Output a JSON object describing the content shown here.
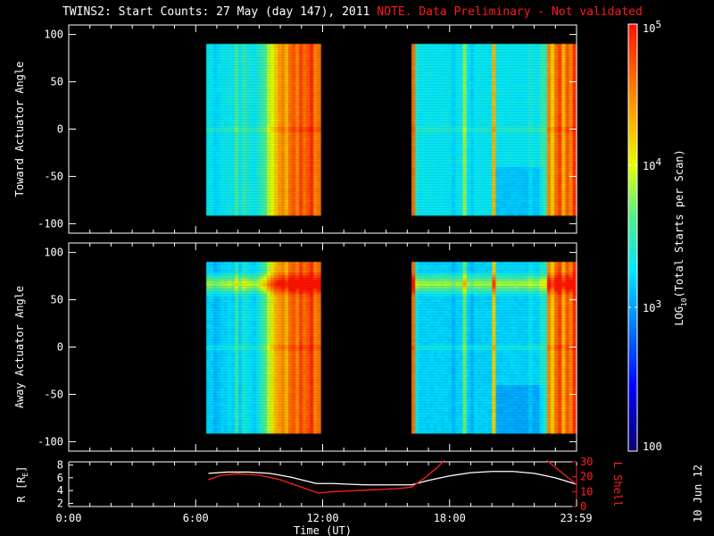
{
  "chart_data": {
    "type": "heatmap",
    "title": "TWINS2: Start Counts: 27 May (day 147), 2011",
    "note": "NOTE. Data Preliminary - Not validated",
    "xlabel": "Time (UT)",
    "x_ticks": [
      "0:00",
      "6:00",
      "12:00",
      "18:00",
      "23:59"
    ],
    "x_tick_hours": [
      0,
      6,
      12,
      18,
      23.98
    ],
    "xlim_hours": [
      0,
      24
    ],
    "panels": [
      {
        "ylabel": "Toward Actuator Angle",
        "ylim": [
          -110,
          110
        ],
        "y_ticks": [
          100,
          50,
          0,
          -50,
          -100
        ],
        "blocks": [
          {
            "start_h": 6.5,
            "end_h": 11.9,
            "angle_range": [
              -90,
              90
            ],
            "col_log10": [
              3.3,
              3.3,
              3.2,
              3.25,
              3.3,
              3.3,
              3.35,
              3.3,
              3.6,
              3.3,
              3.5,
              3.4,
              3.35,
              3.3,
              3.4,
              3.5,
              3.6,
              3.9,
              4.0,
              4.2,
              4.4,
              4.5,
              4.3,
              4.6,
              4.7,
              4.5,
              4.8,
              4.6,
              4.7,
              4.9,
              4.5,
              4.6
            ]
          },
          {
            "start_h": 16.2,
            "end_h": 23.99,
            "angle_range": [
              -90,
              90
            ],
            "col_log10": [
              4.6,
              3.4,
              3.3,
              3.3,
              3.3,
              3.3,
              3.3,
              3.3,
              3.3,
              3.3,
              3.3,
              3.2,
              3.3,
              3.3,
              3.8,
              3.3,
              3.2,
              3.3,
              3.3,
              3.3,
              3.3,
              3.3,
              4.3,
              3.3,
              3.3,
              3.3,
              3.3,
              3.3,
              3.3,
              3.3,
              3.3,
              3.3,
              3.4,
              3.3,
              3.3,
              3.5,
              3.5,
              4.5,
              4.2,
              4.6,
              4.8,
              4.3,
              4.7,
              4.5,
              4.9
            ]
          }
        ]
      },
      {
        "ylabel": "Away Actuator Angle",
        "ylim": [
          -110,
          110
        ],
        "y_ticks": [
          100,
          50,
          0,
          -50,
          -100
        ],
        "blocks": [
          {
            "start_h": 6.5,
            "end_h": 11.9,
            "angle_range": [
              -90,
              90
            ],
            "col_log10": [
              3.2,
              3.2,
              3.1,
              3.15,
              3.2,
              3.2,
              3.25,
              3.2,
              3.5,
              3.2,
              3.4,
              3.3,
              3.25,
              3.2,
              3.3,
              3.5,
              3.6,
              3.9,
              4.1,
              4.3,
              4.4,
              4.5,
              4.3,
              4.6,
              4.7,
              4.5,
              4.8,
              4.6,
              4.7,
              4.9,
              4.5,
              4.6
            ]
          },
          {
            "start_h": 16.2,
            "end_h": 23.99,
            "angle_range": [
              -90,
              90
            ],
            "col_log10": [
              4.6,
              3.3,
              3.2,
              3.2,
              3.2,
              3.2,
              3.2,
              3.2,
              3.2,
              3.2,
              3.2,
              3.1,
              3.2,
              3.2,
              3.7,
              3.2,
              3.1,
              3.2,
              3.2,
              3.2,
              3.2,
              3.2,
              4.2,
              3.2,
              3.2,
              3.2,
              3.2,
              3.2,
              3.2,
              3.2,
              3.2,
              3.2,
              3.3,
              3.2,
              3.2,
              3.4,
              3.4,
              4.5,
              4.2,
              4.6,
              4.8,
              4.3,
              4.7,
              4.5,
              4.9
            ]
          }
        ]
      }
    ],
    "colorbar": {
      "label": "LOG10(Total Starts per Scan)",
      "label_main": "LOG",
      "label_sub": "10",
      "label_rest": "(Total Starts per Scan)",
      "range": [
        100,
        100000
      ],
      "ticks": [
        {
          "base": "10",
          "exp": "5"
        },
        {
          "base": "10",
          "exp": "4"
        },
        {
          "base": "10",
          "exp": "3"
        },
        {
          "base": "100",
          "exp": ""
        }
      ]
    },
    "orbit": {
      "ylabel_left": "R [R",
      "ylabel_left_sub": "E",
      "ylabel_left_end": "]",
      "ylabel_right": "L Shell",
      "left_ylim": [
        1.5,
        8.5
      ],
      "left_ticks": [
        8,
        6,
        4,
        2
      ],
      "right_ylim": [
        0,
        30
      ],
      "right_ticks": [
        30,
        20,
        10,
        0
      ],
      "series": [
        {
          "name": "R",
          "color": "#ffffff",
          "x_hours": [
            6.6,
            7.5,
            8.5,
            9.5,
            10.5,
            11.7,
            12.5,
            14,
            15.5,
            16.2,
            17,
            18,
            19,
            20,
            21,
            22,
            23,
            23.98
          ],
          "y": [
            6.7,
            6.9,
            6.9,
            6.7,
            6.1,
            5.1,
            5.1,
            4.9,
            4.9,
            4.9,
            5.6,
            6.3,
            6.8,
            7.0,
            7.0,
            6.7,
            6.0,
            5.0
          ]
        },
        {
          "name": "L Shell",
          "color": "#ff2020",
          "segments": [
            {
              "x_hours": [
                6.6,
                7.2,
                8,
                9,
                10,
                11,
                11.8,
                12.5,
                14,
                15.5,
                16.2,
                16.8,
                17.4,
                17.75
              ],
              "y": [
                18,
                21,
                22,
                21,
                18,
                13,
                9,
                10,
                11,
                12,
                13,
                19,
                26,
                31
              ]
            },
            {
              "x_hours": [
                22.6,
                23.2,
                23.98
              ],
              "y": [
                31,
                24,
                15
              ]
            }
          ]
        }
      ]
    },
    "side_date": "10 Jun 12"
  },
  "colors": {
    "note": "#ff1a1a",
    "lshell": "#ff2020",
    "axes": "#ffffff",
    "background": "#000000"
  }
}
